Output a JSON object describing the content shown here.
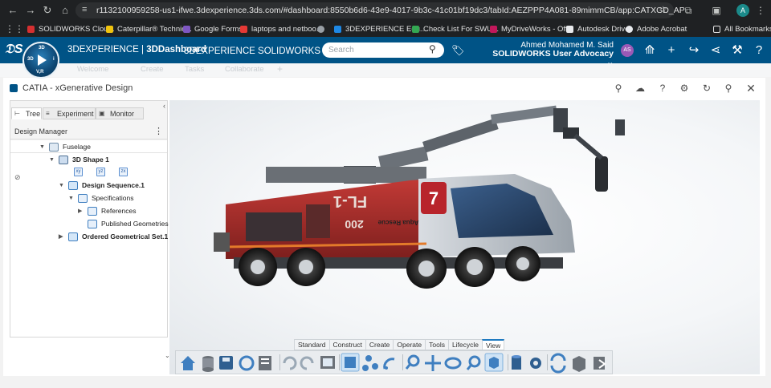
{
  "browser": {
    "url": "r1132100959258-us1-ifwe.3dexperience.3ds.com/#dashboard:8550b6d6-43e9-4017-9b3c-41c01bf19dc3/tabId:AEZPPP4A081-89mimmCB/app:CATXGD_AP",
    "profile_initial": "A",
    "bookmarks": [
      {
        "label": "SOLIDWORKS Clou...",
        "color": "#d63031"
      },
      {
        "label": "Caterpillar® Technic...",
        "color": "#f1c40f"
      },
      {
        "label": "Google Forms",
        "color": "#7e57c2"
      },
      {
        "label": "laptops and netboo...",
        "color": "#e53935"
      },
      {
        "label": "",
        "color": "#9aa0a6"
      },
      {
        "label": "3DEXPERIENCE Edu...",
        "color": "#1e88e5"
      },
      {
        "label": "Check List For SWU...",
        "color": "#34a853"
      },
      {
        "label": "MyDriveWorks - Off...",
        "color": "#c2185b"
      },
      {
        "label": "Autodesk Drive",
        "color": "#e8eaed"
      },
      {
        "label": "Adobe Acrobat",
        "color": "#e8eaed"
      }
    ],
    "all_bookmarks_label": "All Bookmarks"
  },
  "topbar": {
    "brand_prefix": "3DEXPERIENCE",
    "brand_separator": " | ",
    "brand_bold": "3DDashboard",
    "app_name": "3DEXPERIENCE SOLIDWORKS",
    "search_placeholder": "Search",
    "user_name": "Ahmed Mohamed M. Said",
    "user_role": "SOLIDWORKS User Advocacy",
    "avatar_initials": "AS",
    "compass_labels": {
      "top": "3D",
      "left": "3D",
      "right": "i",
      "bottom": "V,R"
    }
  },
  "dashboard_tabs": [
    "Welcome",
    "Create",
    "Tasks",
    "Collaborate",
    "+"
  ],
  "app": {
    "title": "CATIA - xGenerative Design"
  },
  "panel": {
    "tabs": [
      "Tree",
      "Experiment",
      "Monitor"
    ],
    "header": "Design Manager",
    "tree": [
      {
        "label": "Fuselage",
        "bold": false
      },
      {
        "label": "3D Shape 1",
        "bold": true
      },
      {
        "label": "Design Sequence.1",
        "bold": true
      },
      {
        "label": "Specifications",
        "bold": false
      },
      {
        "label": "References",
        "bold": false
      },
      {
        "label": "Published Geometries",
        "bold": false
      },
      {
        "label": "Ordered Geometrical Set.1",
        "bold": true
      }
    ],
    "mini_icons": [
      "xy",
      "yz",
      "zx"
    ]
  },
  "vehicle_decals": {
    "side_text": "FL-1",
    "door_logo": "7",
    "brand_text": "Aqua Rescue",
    "rear_text": "200"
  },
  "action_bar": {
    "tabs": [
      "Standard",
      "Construct",
      "Create",
      "Operate",
      "Tools",
      "Lifecycle",
      "View"
    ],
    "active_tab": "View",
    "buttons": [
      "home-icon",
      "database-icon",
      "save-icon",
      "refresh-icon",
      "properties-icon",
      "undo-icon",
      "redo-icon",
      "screen-capture-icon",
      "layout-icon",
      "network-icon",
      "broadcast-icon",
      "zoom-icon",
      "pan-icon",
      "rotate-icon",
      "zoom-area-icon",
      "view-cube-icon",
      "cylinder-icon",
      "gear-icon",
      "update-icon",
      "3d-box-icon",
      "export-icon"
    ],
    "selected_button": "view-cube-icon"
  }
}
